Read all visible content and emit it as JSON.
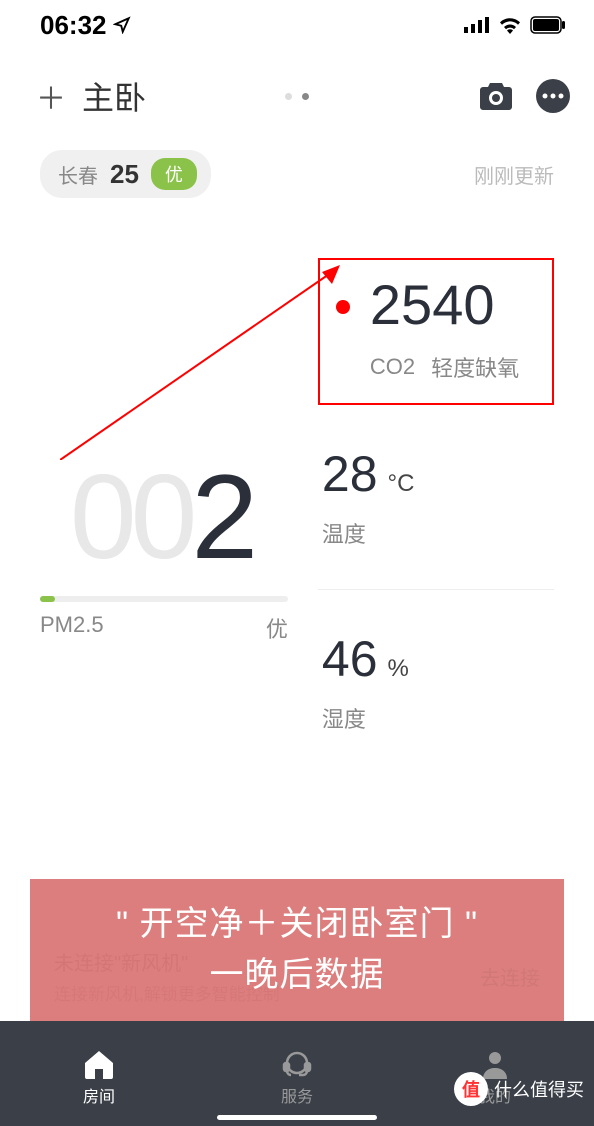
{
  "statusBar": {
    "time": "06:32"
  },
  "header": {
    "roomTitle": "主卧"
  },
  "location": {
    "city": "长春",
    "aqi": "25",
    "quality": "优",
    "updated": "刚刚更新"
  },
  "co2": {
    "value": "2540",
    "label": "CO2",
    "status": "轻度缺氧"
  },
  "temperature": {
    "value": "28",
    "unit": "°C",
    "label": "温度"
  },
  "humidity": {
    "value": "46",
    "unit": "%",
    "label": "湿度"
  },
  "pm25": {
    "leading": "00",
    "value": "2",
    "label": "PM2.5",
    "quality": "优"
  },
  "banner": {
    "line1": "未连接\"新风机\"",
    "line2": "连接新风机,解锁更多智能控制",
    "action": "去连接"
  },
  "caption": {
    "line1": "\" 开空净＋关闭卧室门 \"",
    "line2": "一晚后数据"
  },
  "tabs": {
    "room": "房间",
    "service": "服务",
    "mine": "我的"
  },
  "watermark": {
    "badge": "值",
    "text": "什么值得买"
  }
}
